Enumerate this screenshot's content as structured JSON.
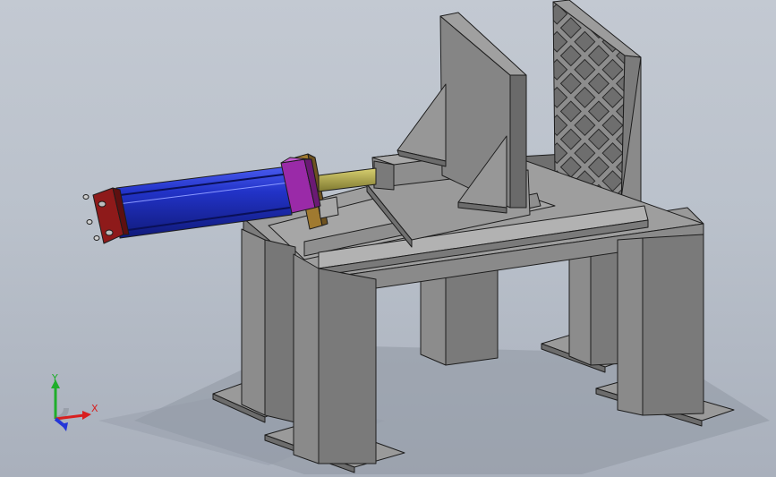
{
  "viewport": {
    "background_top": "#c3c9d2",
    "background_bottom": "#a9b0bc"
  },
  "model": {
    "frame_color": "#8a8a8a",
    "cylinder_color": "#1f2fb8",
    "end_cap_color": "#8e1a1a",
    "flange_color": "#9a2aa8",
    "rod_color": "#a8a040",
    "bracket_color": "#a07a30"
  },
  "triad": {
    "x_label": "X",
    "y_label": "Y",
    "x_color": "#d81f1f",
    "y_color": "#1fae2a",
    "z_color": "#2436d8"
  }
}
